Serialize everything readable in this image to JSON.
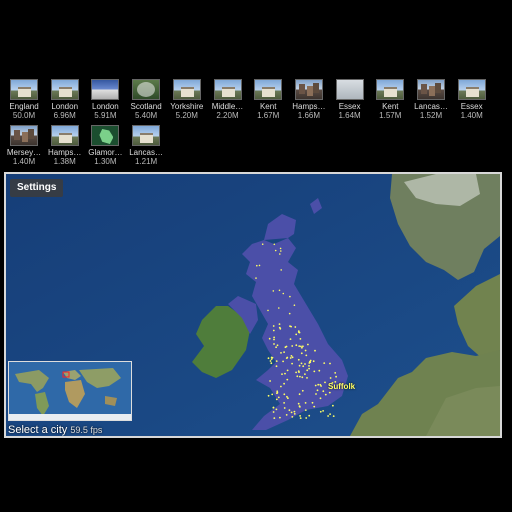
{
  "thumbnails": [
    {
      "name": "England",
      "size": "50.0M",
      "icon": "manor-photo",
      "style": "sky"
    },
    {
      "name": "London",
      "size": "6.96M",
      "icon": "manor-photo",
      "style": "sky"
    },
    {
      "name": "London",
      "size": "5.91M",
      "icon": "flags-photo",
      "style": "blue"
    },
    {
      "name": "Scotland",
      "size": "5.40M",
      "icon": "tree-photo",
      "style": "tree"
    },
    {
      "name": "Yorkshire",
      "size": "5.20M",
      "icon": "manor-photo",
      "style": "sky"
    },
    {
      "name": "Middle…",
      "size": "2.20M",
      "icon": "manor-photo",
      "style": "sky"
    },
    {
      "name": "Kent",
      "size": "1.67M",
      "icon": "house-photo",
      "style": "sky"
    },
    {
      "name": "Hamps…",
      "size": "1.66M",
      "icon": "town-photo",
      "style": "city"
    },
    {
      "name": "Essex",
      "size": "1.64M",
      "icon": "fog-photo",
      "style": "fog"
    },
    {
      "name": "Kent",
      "size": "1.57M",
      "icon": "house-photo",
      "style": "sky"
    },
    {
      "name": "Lancas…",
      "size": "1.52M",
      "icon": "town-photo",
      "style": "city"
    },
    {
      "name": "Essex",
      "size": "1.40M",
      "icon": "manor-photo",
      "style": "sky"
    },
    {
      "name": "Mersey…",
      "size": "1.40M",
      "icon": "town-photo",
      "style": "city"
    },
    {
      "name": "Hamps…",
      "size": "1.38M",
      "icon": "manor-photo",
      "style": "sky"
    },
    {
      "name": "Glamor…",
      "size": "1.30M",
      "icon": "region-map",
      "style": "green"
    },
    {
      "name": "Lancas…",
      "size": "1.21M",
      "icon": "manor-photo",
      "style": "sky"
    }
  ],
  "map": {
    "settings_label": "Settings",
    "status_text": "Select a city",
    "fps_text": "59.5 fps",
    "city_label": "Suffolk",
    "colors": {
      "sea": "#18427a",
      "uk_highlight": "#4b4fa8",
      "city_dot": "#ffff66",
      "land": "#6f7f52"
    }
  }
}
